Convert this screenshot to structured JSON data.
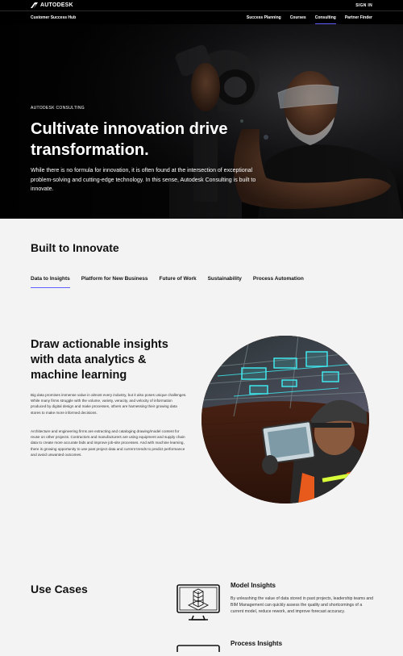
{
  "header": {
    "brand": "AUTODESK",
    "sign_in": "SIGN IN"
  },
  "subnav": {
    "hub": "Customer Success Hub",
    "links": [
      {
        "label": "Success Planning"
      },
      {
        "label": "Courses"
      },
      {
        "label": "Consulting",
        "active": true
      },
      {
        "label": "Partner Finder"
      }
    ]
  },
  "hero": {
    "eyebrow": "AUTODESK CONSULTING",
    "title": "Cultivate innovation drive transformation.",
    "description": "While there is no formula for innovation, it is often found at the intersection of exceptional problem-solving and cutting-edge technology. In this sense, Autodesk Consulting is built to innovate."
  },
  "built": {
    "title": "Built to Innovate",
    "tabs": [
      {
        "label": "Data to Insights",
        "active": true
      },
      {
        "label": "Platform for New Business"
      },
      {
        "label": "Future of Work"
      },
      {
        "label": "Sustainability"
      },
      {
        "label": "Process Automation"
      }
    ]
  },
  "feature": {
    "title": "Draw actionable insights with data analytics & machine learning",
    "paragraph1": "Big data promises immense value in almost every industry, but it also poses unique challenges. While many firms struggle with the volume, variety, veracity, and velocity of information produced by digital design and make processes, others are harnessing their growing data stores to make more informed decisions.",
    "paragraph2": "Architecture and engineering firms are extracting and cataloging drawing/model content for reuse on other projects. Contractors and manufacturers are using equipment and supply chain data to create more accurate bids and improve job-site processes. And with machine learning, there is growing opportunity to use past project data and current trends to predict performance and avoid unwanted outcomes."
  },
  "use_cases": {
    "title": "Use Cases",
    "items": [
      {
        "name": "Model Insights",
        "icon": "monitor-building-icon",
        "description": "By unleashing the value of data stored in past projects, leadership teams and BIM Management can quickly assess the quality and shortcomings of a current model, reduce rework, and improve forecast accuracy."
      },
      {
        "name": "Process Insights",
        "icon": "monitor-icon"
      }
    ]
  },
  "colors": {
    "accent": "#5f60ff",
    "background": "#f3f3f3",
    "dark": "#000000"
  }
}
